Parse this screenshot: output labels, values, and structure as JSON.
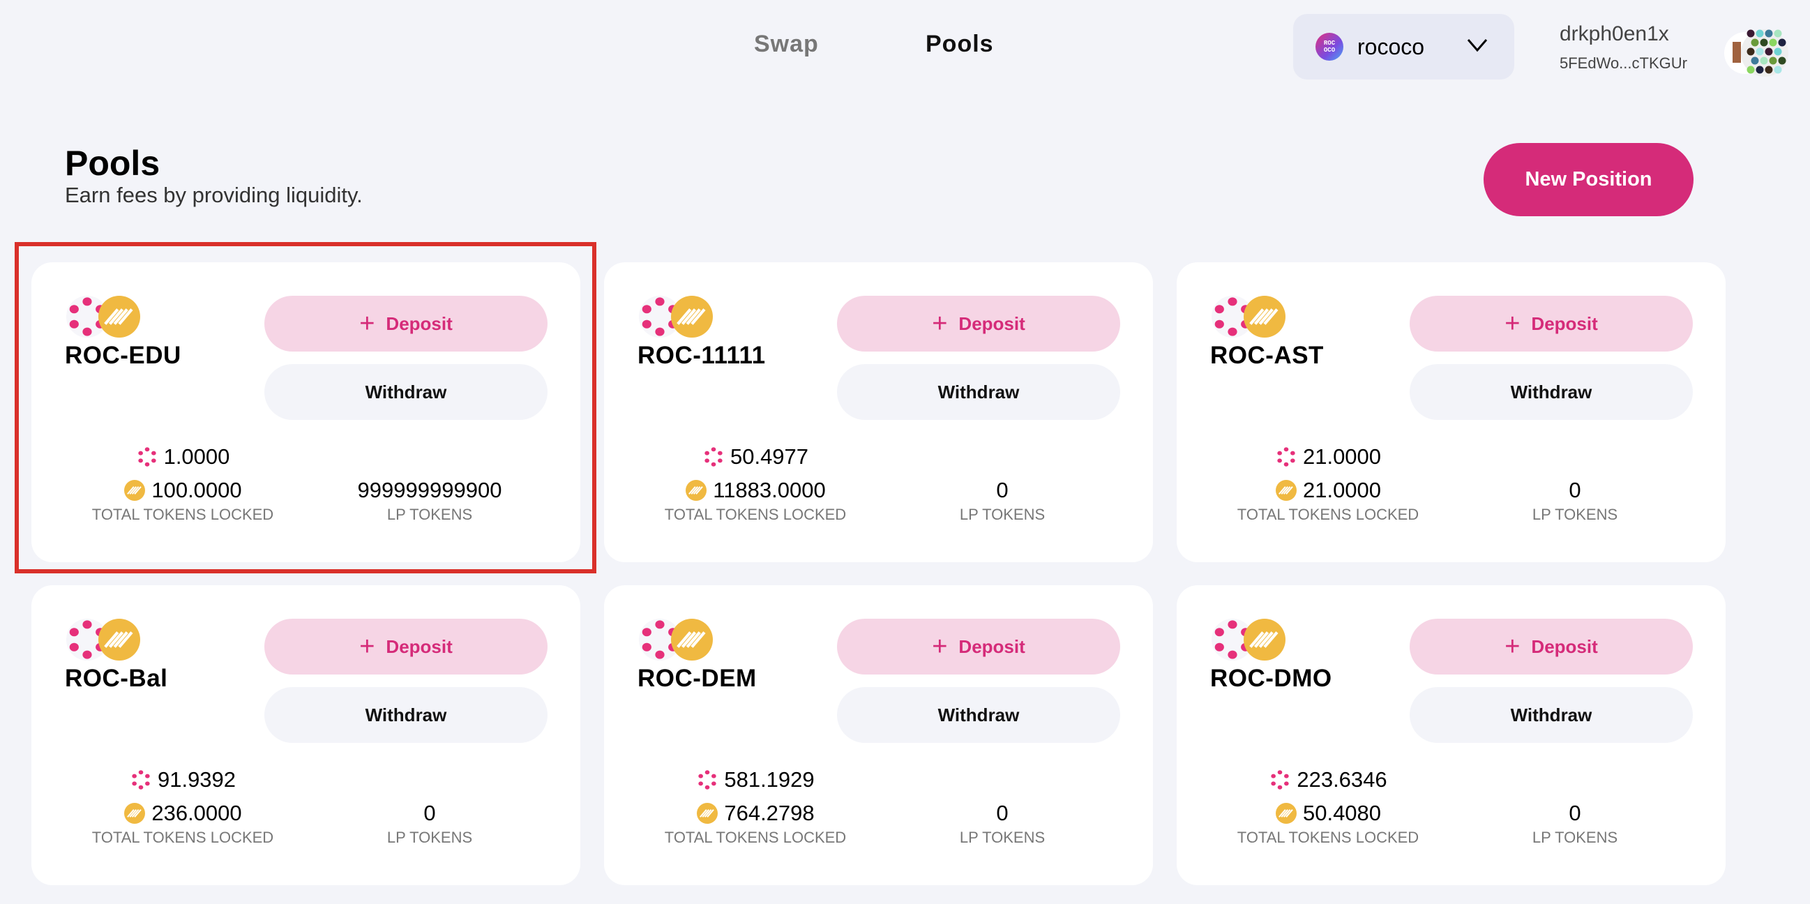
{
  "nav": {
    "swap": "Swap",
    "pools": "Pools"
  },
  "network": {
    "logo_text": "ROC OCO",
    "name": "rococo",
    "icon": "chevron-down-icon"
  },
  "account": {
    "name": "drkph0en1x",
    "address": "5FEdWo...cTKGUr"
  },
  "page": {
    "title": "Pools",
    "subtitle": "Earn fees by providing liquidity.",
    "new_position": "New Position"
  },
  "labels": {
    "deposit": "Deposit",
    "withdraw": "Withdraw",
    "tvl": "TOTAL TOKENS LOCKED",
    "lp": "LP TOKENS"
  },
  "colors": {
    "accent": "#d52b79",
    "highlight": "#d9302a",
    "token_a": "#e6307a",
    "token_b": "#f0b941"
  },
  "pools": [
    {
      "name": "ROC-EDU",
      "amount_a": "1.0000",
      "amount_b": "100.0000",
      "lp": "999999999900",
      "highlighted": true
    },
    {
      "name": "ROC-11111",
      "amount_a": "50.4977",
      "amount_b": "11883.0000",
      "lp": "0"
    },
    {
      "name": "ROC-AST",
      "amount_a": "21.0000",
      "amount_b": "21.0000",
      "lp": "0"
    },
    {
      "name": "ROC-Bal",
      "amount_a": "91.9392",
      "amount_b": "236.0000",
      "lp": "0"
    },
    {
      "name": "ROC-DEM",
      "amount_a": "581.1929",
      "amount_b": "764.2798",
      "lp": "0"
    },
    {
      "name": "ROC-DMO",
      "amount_a": "223.6346",
      "amount_b": "50.4080",
      "lp": "0"
    }
  ]
}
